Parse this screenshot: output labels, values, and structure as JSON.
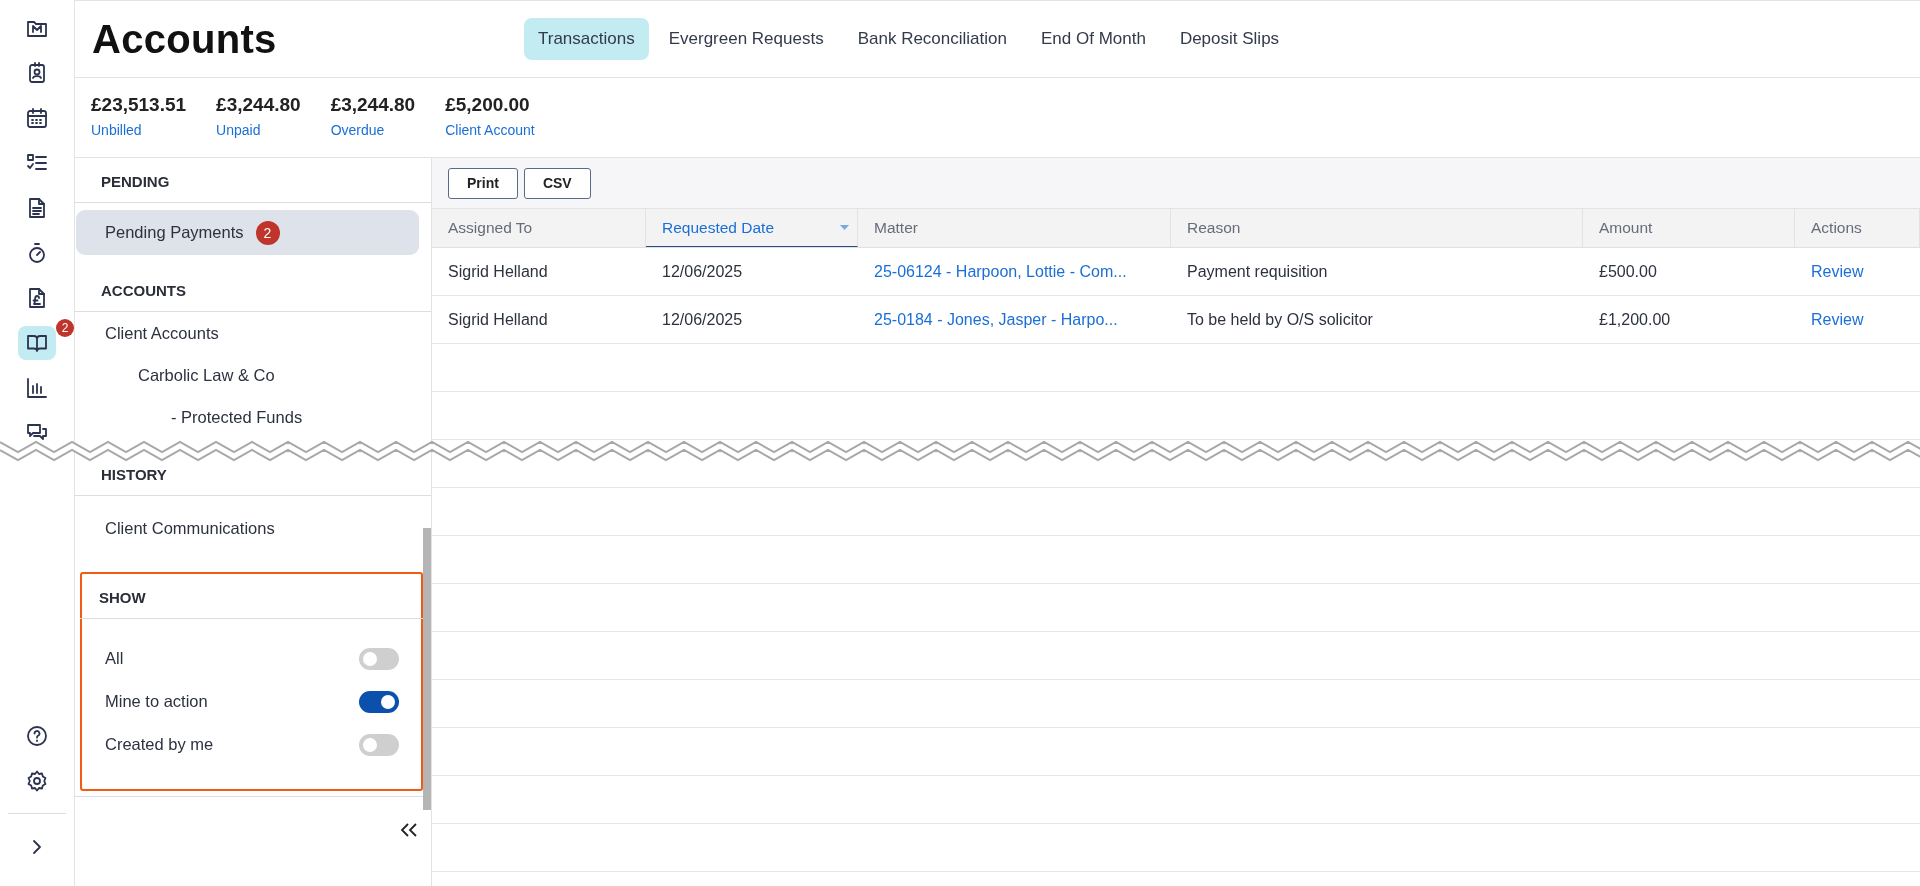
{
  "rail": {
    "items": [
      {
        "selected": false
      },
      {
        "selected": false
      },
      {
        "selected": false
      },
      {
        "selected": false
      },
      {
        "selected": false
      },
      {
        "selected": false
      },
      {
        "selected": false
      },
      {
        "selected": true,
        "badge": "2"
      },
      {
        "selected": false
      },
      {
        "selected": false
      }
    ]
  },
  "header": {
    "title": "Accounts",
    "tabs": [
      {
        "label": "Transactions",
        "selected": true
      },
      {
        "label": "Evergreen Requests",
        "selected": false
      },
      {
        "label": "Bank Reconciliation",
        "selected": false
      },
      {
        "label": "End Of Month",
        "selected": false
      },
      {
        "label": "Deposit Slips",
        "selected": false
      }
    ]
  },
  "stats": [
    {
      "value": "£23,513.51",
      "label": "Unbilled"
    },
    {
      "value": "£3,244.80",
      "label": "Unpaid"
    },
    {
      "value": "£3,244.80",
      "label": "Overdue"
    },
    {
      "value": "£5,200.00",
      "label": "Client Account"
    }
  ],
  "sidebar": {
    "sections": [
      {
        "heading": "PENDING",
        "items": [
          {
            "label": "Pending Payments",
            "selected": true,
            "badge": "2"
          }
        ]
      },
      {
        "heading": "ACCOUNTS",
        "items": [
          {
            "label": "Client Accounts",
            "selected": false,
            "children": [
              {
                "label": "Carbolic Law & Co",
                "selected": false,
                "children": [
                  {
                    "label": "- Protected Funds",
                    "selected": false
                  }
                ]
              }
            ]
          }
        ]
      },
      {
        "heading": "HISTORY",
        "items": [
          {
            "label": "Client Communications",
            "selected": false
          }
        ]
      }
    ],
    "show": {
      "heading": "SHOW",
      "highlighted": true,
      "toggles": [
        {
          "label": "All",
          "on": false
        },
        {
          "label": "Mine to action",
          "on": true
        },
        {
          "label": "Created by me",
          "on": false
        }
      ]
    }
  },
  "toolbar": {
    "buttons": [
      "Print",
      "CSV"
    ]
  },
  "table": {
    "columns": [
      {
        "label": "Assigned To",
        "sorted": false,
        "kind": "text"
      },
      {
        "label": "Requested Date",
        "sorted": true,
        "kind": "text"
      },
      {
        "label": "Matter",
        "sorted": false,
        "kind": "link"
      },
      {
        "label": "Reason",
        "sorted": false,
        "kind": "text"
      },
      {
        "label": "Amount",
        "sorted": false,
        "kind": "text"
      },
      {
        "label": "Actions",
        "sorted": false,
        "kind": "link"
      }
    ],
    "rows": [
      [
        "Sigrid Helland",
        "12/06/2025",
        "25-06124 - Harpoon, Lottie - Com...",
        "Payment requisition",
        "£500.00",
        "Review"
      ],
      [
        "Sigrid Helland",
        "12/06/2025",
        "25-0184 - Jones, Jasper - Harpo...",
        "To be held by O/S solicitor",
        "£1,200.00",
        "Review"
      ]
    ]
  }
}
